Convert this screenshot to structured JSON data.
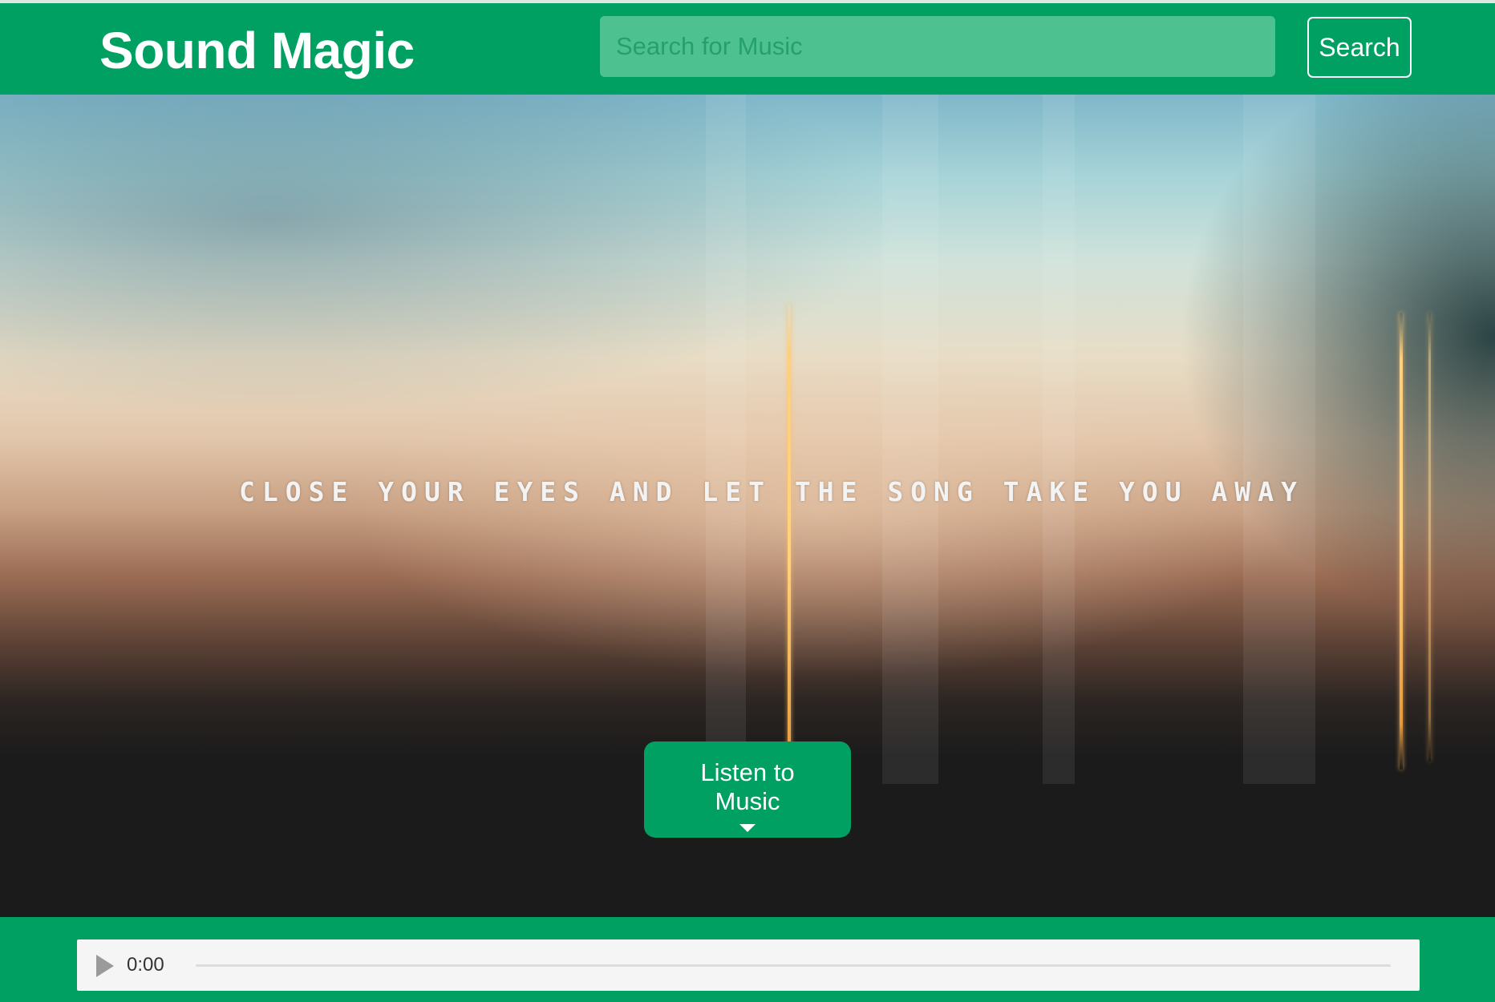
{
  "header": {
    "brand": "Sound Magic",
    "search_placeholder": "Search for Music",
    "search_value": "",
    "search_button": "Search"
  },
  "hero": {
    "tagline": "CLOSE YOUR EYES AND LET THE SONG TAKE YOU AWAY",
    "listen_button": "Listen to Music",
    "listen_icon": "caret-down-icon"
  },
  "player": {
    "time": "0:00",
    "play_icon": "play-icon",
    "progress": 0
  },
  "colors": {
    "brand_green": "#00a062",
    "search_bg": "#4dc290",
    "dark_bg": "#1b1b1b"
  }
}
